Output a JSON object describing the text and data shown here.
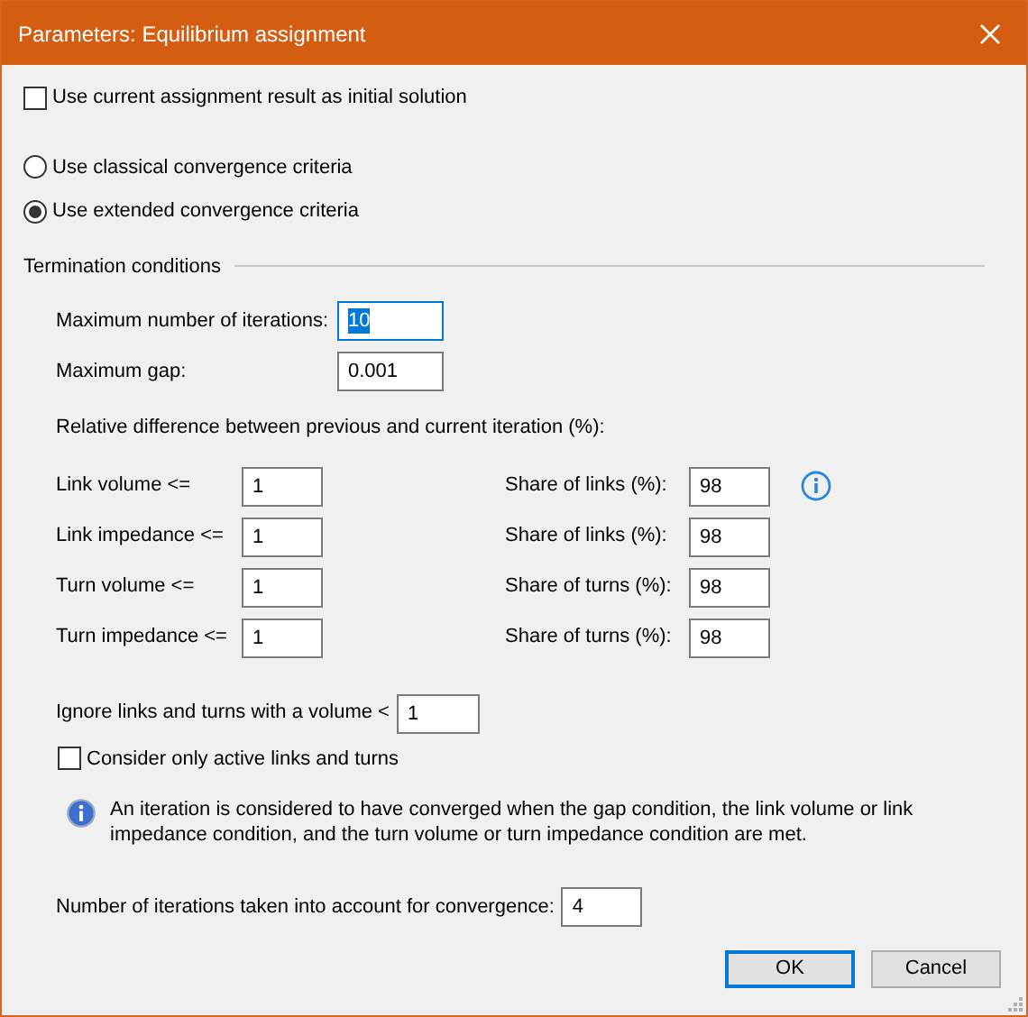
{
  "window": {
    "title": "Parameters: Equilibrium assignment"
  },
  "initial_solution": {
    "label": "Use current assignment result as initial solution",
    "checked": false
  },
  "criteria": [
    {
      "label": "Use classical convergence criteria",
      "selected": false
    },
    {
      "label": "Use extended convergence criteria",
      "selected": true
    }
  ],
  "termination": {
    "title": "Termination conditions",
    "fields": [
      {
        "label": "Maximum number of iterations:",
        "value": "10",
        "focused": true
      },
      {
        "label": "Maximum gap:",
        "value": "0.001",
        "focused": false
      }
    ],
    "relative_heading": "Relative difference between previous and current iteration (%):",
    "rows": [
      {
        "label": "Link volume <=",
        "value": "1",
        "share_label": "Share of links (%):",
        "share_value": "98",
        "info": true
      },
      {
        "label": "Link impedance <=",
        "value": "1",
        "share_label": "Share of links (%):",
        "share_value": "98",
        "info": false
      },
      {
        "label": "Turn volume <=",
        "value": "1",
        "share_label": "Share of turns (%):",
        "share_value": "98",
        "info": false
      },
      {
        "label": "Turn impedance <=",
        "value": "1",
        "share_label": "Share of turns (%):",
        "share_value": "98",
        "info": false
      }
    ],
    "ignore": {
      "label": "Ignore links and turns with a volume <",
      "value": "1"
    },
    "active_only": {
      "label": "Consider only active links and turns",
      "checked": false
    },
    "note": "An iteration is considered to have converged when the gap condition, the link volume or link impedance condition, and the turn volume or turn impedance condition are met.",
    "iterations": {
      "label": "Number of iterations taken into account for convergence:",
      "value": "4"
    }
  },
  "buttons": [
    {
      "label": "OK",
      "default": true
    },
    {
      "label": "Cancel",
      "default": false
    }
  ]
}
